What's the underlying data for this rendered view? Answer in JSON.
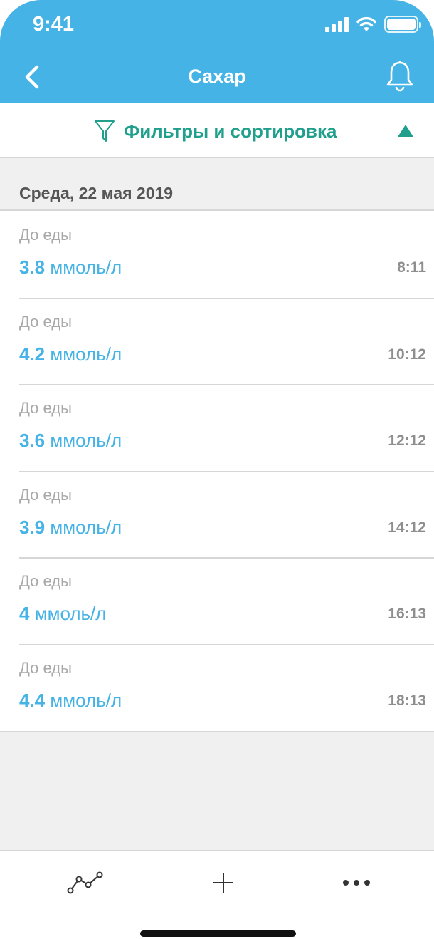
{
  "status_bar": {
    "time": "9:41"
  },
  "header": {
    "title": "Сахар"
  },
  "filter": {
    "label": "Фильтры и сортировка"
  },
  "date_header": "Среда, 22 мая 2019",
  "entries": [
    {
      "category": "До еды",
      "value": "3.8",
      "unit": "ммоль/л",
      "time": "8:11"
    },
    {
      "category": "До еды",
      "value": "4.2",
      "unit": "ммоль/л",
      "time": "10:12"
    },
    {
      "category": "До еды",
      "value": "3.6",
      "unit": "ммоль/л",
      "time": "12:12"
    },
    {
      "category": "До еды",
      "value": "3.9",
      "unit": "ммоль/л",
      "time": "14:12"
    },
    {
      "category": "До еды",
      "value": "4",
      "unit": "ммоль/л",
      "time": "16:13"
    },
    {
      "category": "До еды",
      "value": "4.4",
      "unit": "ммоль/л",
      "time": "18:13"
    }
  ],
  "tabbar": {
    "icons": [
      "chart-line-icon",
      "plus-icon",
      "more-icon"
    ]
  },
  "colors": {
    "header_bg": "#45b3e5",
    "accent_teal": "#1f9f8c",
    "value_blue": "#45b3e5"
  }
}
